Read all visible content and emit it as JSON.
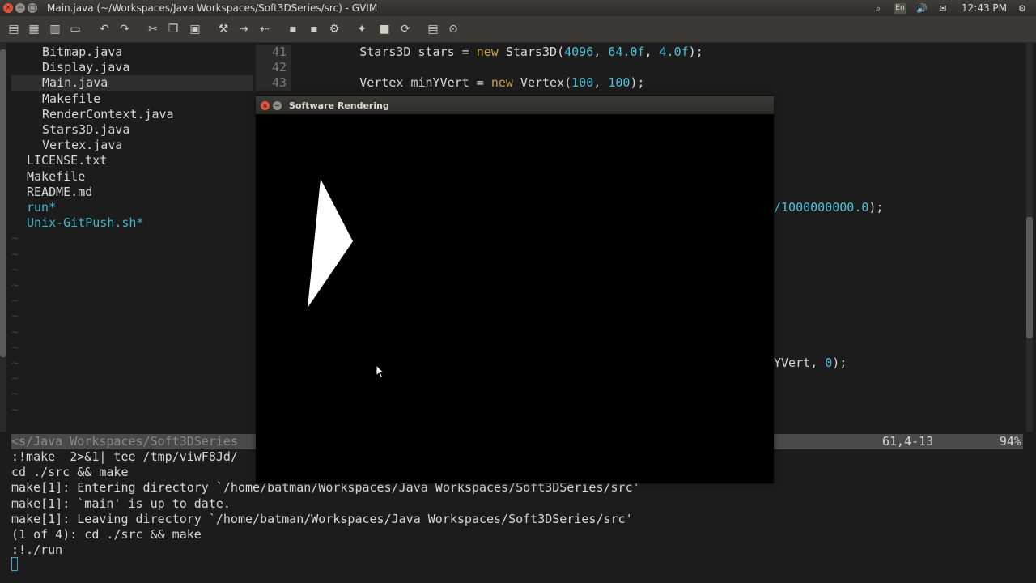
{
  "window": {
    "title": "Main.java (~/Workspaces/Java Workspaces/Soft3DSeries/src) - GVIM",
    "close_glyph": "×",
    "minimize_glyph": "−",
    "maximize_glyph": "□"
  },
  "panel": {
    "indicators": [
      {
        "name": "search-indicator-icon",
        "glyph": "⌕"
      },
      {
        "name": "keyboard-layout-indicator",
        "glyph": "En"
      },
      {
        "name": "volume-icon",
        "glyph": "🔊"
      },
      {
        "name": "mail-icon",
        "glyph": "✉"
      }
    ],
    "clock": "12:43 PM",
    "gear_glyph": "⚙"
  },
  "toolbar": {
    "buttons": [
      {
        "name": "open-file-icon",
        "glyph": "▤"
      },
      {
        "name": "save-icon",
        "glyph": "▦"
      },
      {
        "name": "save-all-icon",
        "glyph": "▥"
      },
      {
        "name": "print-icon",
        "glyph": "▭"
      },
      {
        "name": "undo-icon",
        "glyph": "↶"
      },
      {
        "name": "redo-icon",
        "glyph": "↷"
      },
      {
        "name": "cut-icon",
        "glyph": "✂"
      },
      {
        "name": "copy-icon",
        "glyph": "❐"
      },
      {
        "name": "paste-icon",
        "glyph": "▣"
      },
      {
        "name": "find-replace-icon",
        "glyph": "⚒"
      },
      {
        "name": "find-next-icon",
        "glyph": "⇢"
      },
      {
        "name": "find-prev-icon",
        "glyph": "⇠"
      },
      {
        "name": "load-session-icon",
        "glyph": "▪"
      },
      {
        "name": "save-session-icon",
        "glyph": "▪"
      },
      {
        "name": "run-script-icon",
        "glyph": "⚙"
      },
      {
        "name": "make-icon",
        "glyph": "✦"
      },
      {
        "name": "build-tags-icon",
        "glyph": "■"
      },
      {
        "name": "jump-tag-icon",
        "glyph": "⟳"
      },
      {
        "name": "help-icon",
        "glyph": "▤"
      },
      {
        "name": "find-help-icon",
        "glyph": "⊙"
      }
    ]
  },
  "file_tree": {
    "items": [
      {
        "label": "Bitmap.java",
        "kind": "file",
        "indent": 2
      },
      {
        "label": "Display.java",
        "kind": "file",
        "indent": 2
      },
      {
        "label": "Main.java",
        "kind": "file",
        "indent": 2,
        "selected": true
      },
      {
        "label": "Makefile",
        "kind": "file",
        "indent": 2
      },
      {
        "label": "RenderContext.java",
        "kind": "file",
        "indent": 2
      },
      {
        "label": "Stars3D.java",
        "kind": "file",
        "indent": 2
      },
      {
        "label": "Vertex.java",
        "kind": "file",
        "indent": 2
      },
      {
        "label": "LICENSE.txt",
        "kind": "file",
        "indent": 1
      },
      {
        "label": "Makefile",
        "kind": "file",
        "indent": 1
      },
      {
        "label": "README.md",
        "kind": "file",
        "indent": 1
      },
      {
        "label": "run*",
        "kind": "exec",
        "indent": 1
      },
      {
        "label": "Unix-GitPush.sh*",
        "kind": "exec",
        "indent": 1
      }
    ],
    "empty_marker": "~",
    "empty_rows": 12
  },
  "code": {
    "lines": [
      {
        "num": "41",
        "segments": [
          {
            "t": "        Stars3D stars = ",
            "c": ""
          },
          {
            "t": "new",
            "c": "kw"
          },
          {
            "t": " Stars3D(",
            "c": ""
          },
          {
            "t": "4096",
            "c": "num"
          },
          {
            "t": ", ",
            "c": ""
          },
          {
            "t": "64.0f",
            "c": "num"
          },
          {
            "t": ", ",
            "c": ""
          },
          {
            "t": "4.0f",
            "c": "num"
          },
          {
            "t": ");",
            "c": ""
          }
        ]
      },
      {
        "num": "42",
        "segments": []
      },
      {
        "num": "43",
        "segments": [
          {
            "t": "        Vertex minYVert = ",
            "c": ""
          },
          {
            "t": "new",
            "c": "kw"
          },
          {
            "t": " Vertex(",
            "c": ""
          },
          {
            "t": "100",
            "c": "num"
          },
          {
            "t": ", ",
            "c": ""
          },
          {
            "t": "100",
            "c": "num"
          },
          {
            "t": ");",
            "c": ""
          }
        ]
      }
    ],
    "partial_right": [
      {
        "text": "/1000000000.0",
        "tail": ");"
      },
      {
        "text": "YVert, ",
        "num": "0",
        "tail": ");"
      }
    ]
  },
  "statusline": {
    "path": "<s/Java Workspaces/Soft3DSeries",
    "position": "61,4-13",
    "percent": "94%"
  },
  "command_output": [
    ":!make  2>&1| tee /tmp/viwF8Jd/",
    "cd ./src && make",
    "make[1]: Entering directory `/home/batman/Workspaces/Java Workspaces/Soft3DSeries/src'",
    "make[1]: `main' is up to date.",
    "make[1]: Leaving directory `/home/batman/Workspaces/Java Workspaces/Soft3DSeries/src'",
    "(1 of 4): cd ./src && make",
    ":!./run"
  ],
  "render_window": {
    "title": "Software Rendering",
    "close_glyph": "×",
    "minimize_glyph": "−",
    "background": "#000000",
    "triangle_color": "#ffffff"
  },
  "colors": {
    "accent_teal": "#3fb8c9",
    "keyword": "#c8a24a",
    "number": "#4fc2d8"
  }
}
